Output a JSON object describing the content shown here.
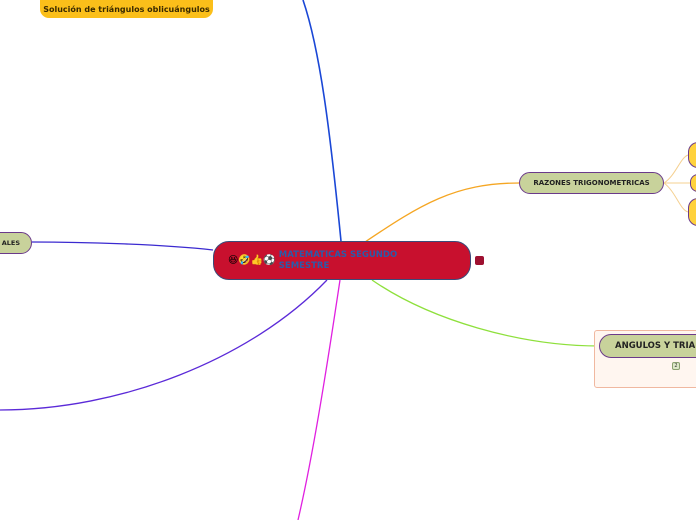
{
  "central": {
    "emojis": "😆🤣👍⚽",
    "title": "MATEMATICAS SEGUNDO SEMESTRE"
  },
  "topics": {
    "oblicuangulos": "Solución de triángulos oblicuángulos",
    "razones": "RAZONES TRIGONOMETRICAS",
    "angulos": "ANGULOS Y TRIA",
    "angulos_count": "2",
    "left": "ALES"
  },
  "colors": {
    "central_fill": "#c8102e",
    "central_border": "#3b4b7a",
    "central_text": "#2a5caa",
    "topic_fill": "#c8d29b",
    "topic_border": "#6b3a8a",
    "yellow_topic": "#fbbf1a",
    "branch_blue": "#1a47d6",
    "branch_orange": "#f5a623",
    "branch_green": "#8ee03c",
    "branch_purple": "#5b2ad8",
    "branch_indigo": "#3b2ad0",
    "branch_magenta": "#e020e0"
  }
}
